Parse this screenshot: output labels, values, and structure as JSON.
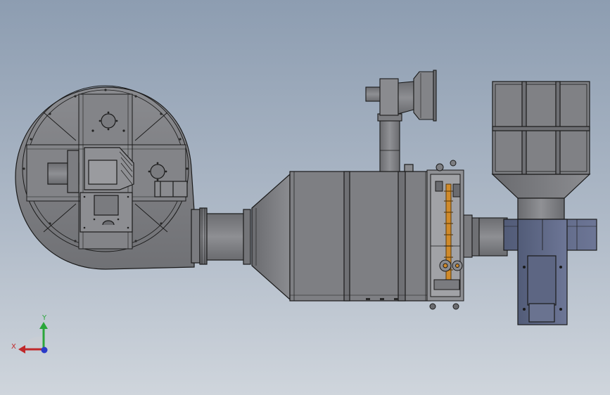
{
  "view": {
    "background_top": "#8d9db1",
    "background_bottom": "#cfd5dc",
    "metal_fill": "#7c7d81",
    "metal_dark": "#5e5f63",
    "edge_color": "#1a1a1a",
    "accent_orange": "#d08a2a",
    "accent_blue": "#5a6a8c"
  },
  "triad": {
    "x_label": "X",
    "y_label": "Y",
    "x_color": "#c0282a",
    "y_color": "#2aa63a",
    "z_color": "#2a3ac8"
  }
}
